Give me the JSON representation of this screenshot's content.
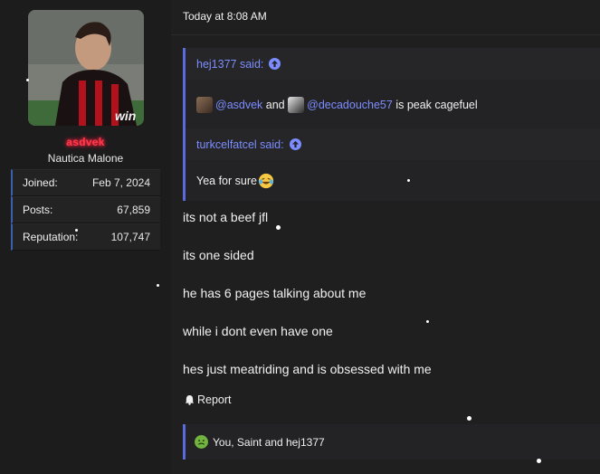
{
  "user": {
    "username": "asdvek",
    "title": "Nautica Malone",
    "stats": [
      {
        "label": "Joined:",
        "value": "Feb 7, 2024"
      },
      {
        "label": "Posts:",
        "value": "67,859"
      },
      {
        "label": "Reputation:",
        "value": "107,747"
      }
    ]
  },
  "post": {
    "timestamp": "Today at 8:08 AM",
    "quotes": [
      {
        "author_line": "hej1377 said:",
        "mention1": "@asdvek",
        "and_word": "and",
        "mention2": "@decadouche57",
        "tail": "is peak cagefuel"
      },
      {
        "author_line": "turkcelfatcel said:",
        "text": "Yea for sure"
      }
    ],
    "lines": [
      "its not a beef jfl",
      "its one sided",
      "he has 6 pages talking about me",
      "while i dont even have one",
      "hes just meatriding and is obsessed with me"
    ],
    "report_label": "Report",
    "reactions_text": "You, Saint and hej1377"
  },
  "colors": {
    "accent": "#5a6be0",
    "mention": "#7b8dff",
    "username": "#ff3b4a"
  }
}
